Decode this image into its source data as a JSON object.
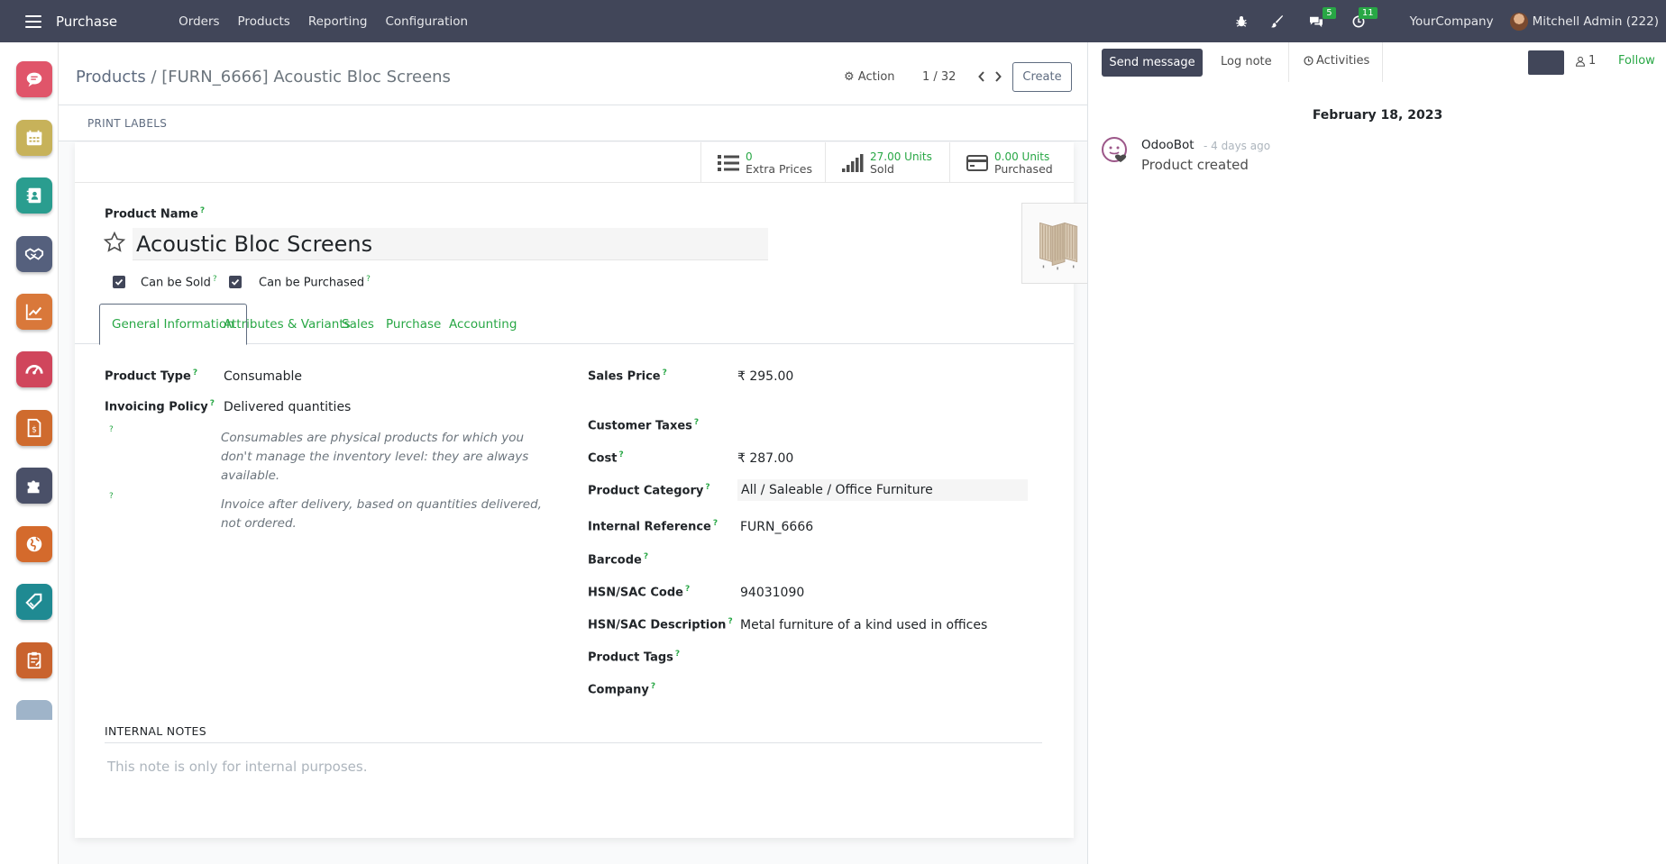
{
  "navbar": {
    "app_name": "Purchase",
    "menu": [
      "Orders",
      "Products",
      "Reporting",
      "Configuration"
    ],
    "messages_badge": "5",
    "activities_badge": "11",
    "company": "YourCompany",
    "user": "Mitchell Admin (222)",
    "icons": [
      "menu-icon",
      "bug-icon",
      "brush-icon",
      "chat-icon",
      "clock-icon"
    ]
  },
  "apps": [
    "discuss",
    "calendar",
    "contacts",
    "crm",
    "sales",
    "dashboards",
    "invoicing",
    "apps",
    "website",
    "inventory",
    "purchase"
  ],
  "control_panel": {
    "breadcrumb_parent": "Products",
    "breadcrumb_sep": " / ",
    "breadcrumb_current": "[FURN_6666] Acoustic Bloc Screens",
    "action_label": "Action",
    "pager": "1 / 32",
    "create_label": "Create"
  },
  "statusbar": {
    "print_labels": "PRINT LABELS"
  },
  "smart_buttons": [
    {
      "value": "0",
      "label": "Extra Prices",
      "icon": "list-icon"
    },
    {
      "value": "27.00 Units",
      "label": "Sold",
      "icon": "signal-icon"
    },
    {
      "value": "0.00 Units",
      "label": "Purchased",
      "icon": "credit-card-icon"
    }
  ],
  "product": {
    "name_label": "Product Name",
    "name": "Acoustic Bloc Screens",
    "can_be_sold_label": "Can be Sold",
    "can_be_purchased_label": "Can be Purchased",
    "can_be_sold": true,
    "can_be_purchased": true
  },
  "tabs": [
    "General Information",
    "Attributes & Variants",
    "Sales",
    "Purchase",
    "Accounting"
  ],
  "general": {
    "product_type_label": "Product Type",
    "product_type": "Consumable",
    "invoicing_policy_label": "Invoicing Policy",
    "invoicing_policy": "Delivered quantities",
    "help_type_1": "Consumables are physical products for which you",
    "help_type_2": "don't manage the inventory level: they are always",
    "help_type_3": "available.",
    "help_invoice_1": "Invoice after delivery, based on quantities delivered,",
    "help_invoice_2": "not ordered.",
    "sales_price_label": "Sales Price",
    "sales_price": "₹ 295.00",
    "customer_taxes_label": "Customer Taxes",
    "cost_label": "Cost",
    "cost": "₹ 287.00",
    "category_label": "Product Category",
    "category": "All / Saleable / Office Furniture",
    "internal_ref_label": "Internal Reference",
    "internal_ref": "FURN_6666",
    "barcode_label": "Barcode",
    "hsn_code_label": "HSN/SAC Code",
    "hsn_code": "94031090",
    "hsn_desc_label": "HSN/SAC Description",
    "hsn_desc": "Metal furniture of a kind used in offices",
    "tags_label": "Product Tags",
    "company_label": "Company",
    "help_marker": "?"
  },
  "notes": {
    "heading": "INTERNAL NOTES",
    "placeholder": "This note is only for internal purposes."
  },
  "chatter": {
    "send_message": "Send message",
    "log_note": "Log note",
    "activities": "Activities",
    "followers_count": "1",
    "follow": "Follow",
    "date": "February 18, 2023",
    "author": "OdooBot",
    "time": "- 4 days ago",
    "body": "Product created"
  },
  "colors": {
    "navbar": "#414659",
    "accent_green": "#28a745",
    "brand": "#5f6c80"
  }
}
